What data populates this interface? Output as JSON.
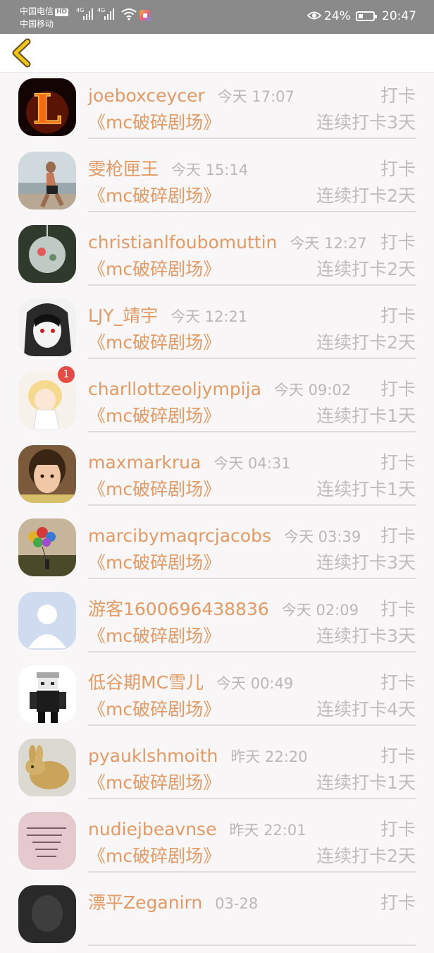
{
  "status_bar": {
    "carrier_1": "中国电信",
    "hd_label": "HD",
    "carrier_2": "中国移动",
    "network_1": "4G",
    "network_2": "4G",
    "battery_pct": "24%",
    "time": "20:47"
  },
  "nav": {
    "back_icon": "chevron-left-icon",
    "accent": "#f0c419"
  },
  "list": {
    "items": [
      {
        "name": "joeboxceycer",
        "time": "今天 17:07",
        "action": "打卡",
        "topic": "《mc破碎剧场》",
        "streak": "连续打卡3天",
        "avatar": "flame-letter"
      },
      {
        "name": "雯枪匣王",
        "time": "今天 15:14",
        "action": "打卡",
        "topic": "《mc破碎剧场》",
        "streak": "连续打卡2天",
        "avatar": "runner-photo"
      },
      {
        "name": "christianlfoubomuttin",
        "time": "今天 12:27",
        "action": "打卡",
        "topic": "《mc破碎剧场》",
        "streak": "连续打卡2天",
        "avatar": "glass-orb"
      },
      {
        "name": "LJY_靖宇",
        "time": "今天 12:21",
        "action": "打卡",
        "topic": "《mc破碎剧场》",
        "streak": "连续打卡2天",
        "avatar": "anime-hood"
      },
      {
        "name": "charllottzeoljympija",
        "time": "今天 09:02",
        "action": "打卡",
        "topic": "《mc破碎剧场》",
        "streak": "连续打卡1天",
        "avatar": "anime-girl",
        "badge": "1"
      },
      {
        "name": "maxmarkrua",
        "time": "今天 04:31",
        "action": "打卡",
        "topic": "《mc破碎剧场》",
        "streak": "连续打卡1天",
        "avatar": "portrait-photo"
      },
      {
        "name": "marcibymaqrcjacobs",
        "time": "今天 03:39",
        "action": "打卡",
        "topic": "《mc破碎剧场》",
        "streak": "连续打卡3天",
        "avatar": "balloons-photo"
      },
      {
        "name": "游客1600696438836",
        "time": "今天 02:09",
        "action": "打卡",
        "topic": "《mc破碎剧场》",
        "streak": "连续打卡3天",
        "avatar": "default-user"
      },
      {
        "name": "低谷期MC雪儿",
        "time": "今天 00:49",
        "action": "打卡",
        "topic": "《mc破碎剧场》",
        "streak": "连续打卡4天",
        "avatar": "pixel-character"
      },
      {
        "name": "pyauklshmoith",
        "time": "昨天 22:20",
        "action": "打卡",
        "topic": "《mc破碎剧场》",
        "streak": "连续打卡1天",
        "avatar": "rabbit-carving"
      },
      {
        "name": "nudiejbeavnse",
        "time": "昨天 22:01",
        "action": "打卡",
        "topic": "《mc破碎剧场》",
        "streak": "连续打卡2天",
        "avatar": "pink-text-card"
      },
      {
        "name": "漂平Zeganirn",
        "time": "03-28",
        "action": "打卡",
        "topic": "",
        "streak": "",
        "avatar": "dark-photo"
      }
    ]
  },
  "colors": {
    "accent_orange": "#e39a64",
    "muted_gray": "#bdbdbd",
    "badge_red": "#e54b45"
  }
}
